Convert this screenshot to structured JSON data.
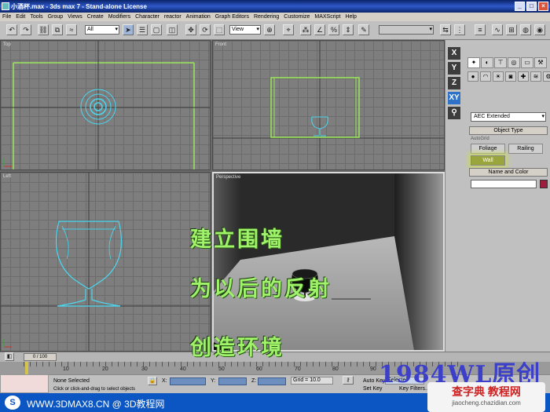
{
  "window": {
    "title": "小酒杯.max - 3ds max 7 - Stand-alone License"
  },
  "menu": [
    "File",
    "Edit",
    "Tools",
    "Group",
    "Views",
    "Create",
    "Modifiers",
    "Character",
    "reactor",
    "Animation",
    "Graph Editors",
    "Rendering",
    "Customize",
    "MAXScript",
    "Help"
  ],
  "toolbar": {
    "filter": "All",
    "refcoord": "View"
  },
  "viewports": {
    "top": "Top",
    "front": "Front",
    "left": "Left",
    "perspective": "Perspective"
  },
  "axis_buttons": [
    "X",
    "Y",
    "Z",
    "XY"
  ],
  "command_panel": {
    "category": "AEC Extended",
    "object_type_header": "Object Type",
    "autogrid": "AutoGrid",
    "buttons": [
      "Foliage",
      "Railing",
      "Wall"
    ],
    "name_color_header": "Name and Color"
  },
  "overlay": {
    "line1": "建立围墙",
    "line2": "为以后的反射",
    "line3": "创造环境"
  },
  "timeline": {
    "frame": "0 / 100",
    "ticks": [
      "10",
      "20",
      "30",
      "40",
      "50",
      "60",
      "70",
      "80",
      "90"
    ]
  },
  "status": {
    "selection": "None Selected",
    "prompt": "Click or click-and-drag to select objects",
    "x_label": "X:",
    "y_label": "Y:",
    "z_label": "Z:",
    "grid": "Grid = 10.0",
    "autokey": "Auto Key",
    "selected": "Selecte",
    "setkey": "Set Key",
    "keyfilters": "Key Filters..."
  },
  "watermark": "1984WL原创",
  "footer": {
    "text": "WWW.3DMAX8.CN @ 3D教程网",
    "site_name": "查字典 教程网",
    "site_url": "jiaocheng.chazidian.com"
  }
}
